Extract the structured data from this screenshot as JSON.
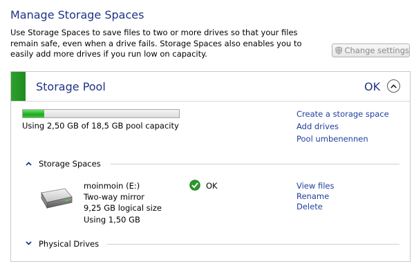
{
  "header": {
    "title": "Manage Storage Spaces",
    "description": "Use Storage Spaces to save files to two or more drives so that your files remain safe, even when a drive fails. Storage Spaces also enables you to easily add more drives if you run low on capacity.",
    "change_settings_label": "Change settings"
  },
  "pool": {
    "name": "Storage Pool",
    "status": "OK",
    "used_fraction": 0.135,
    "capacity_text": "Using 2,50 GB of 18,5 GB pool capacity",
    "links": [
      "Create a storage space",
      "Add drives",
      "Pool umbenennen"
    ]
  },
  "storage_spaces": {
    "section_label": "Storage Spaces",
    "space": {
      "name": "moinmoin (E:)",
      "resiliency": "Two-way mirror",
      "logical_size": "9,25 GB logical size",
      "used": "Using 1,50 GB",
      "status": "OK",
      "links": [
        "View files",
        "Rename",
        "Delete"
      ]
    }
  },
  "physical_drives": {
    "section_label": "Physical Drives"
  },
  "colors": {
    "heading": "#1e3287",
    "link": "#1e3fa0",
    "status_green": "#1e8c1e"
  },
  "icons": {
    "shield": "uac-shield-icon",
    "collapse": "chevron-up-icon",
    "drive": "hard-drive-icon",
    "ok": "checkmark-icon"
  }
}
